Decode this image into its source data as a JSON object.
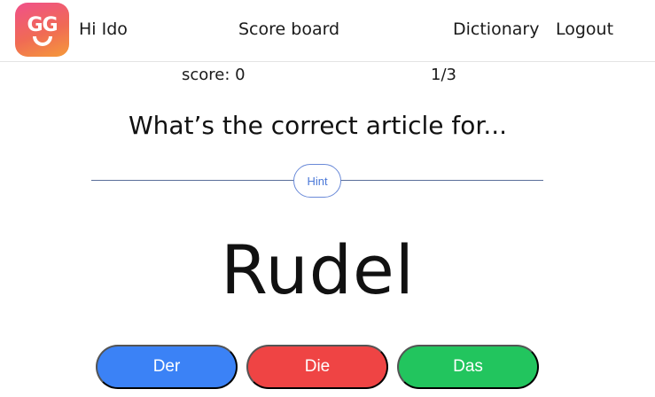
{
  "header": {
    "logo_text": "GG",
    "greeting": "Hi Ido",
    "nav": {
      "scoreboard": "Score board",
      "dictionary": "Dictionary",
      "logout": "Logout"
    }
  },
  "stats": {
    "score": "score: 0",
    "progress": "1/3"
  },
  "quiz": {
    "question": "What’s the correct article for...",
    "hint_label": "Hint",
    "word": "Rudel"
  },
  "answers": [
    {
      "label": "Der",
      "color": "#3b82f6"
    },
    {
      "label": "Die",
      "color": "#ef4444"
    },
    {
      "label": "Das",
      "color": "#22c55e"
    }
  ],
  "colors": {
    "logo_gradient_start": "#f0508a",
    "logo_gradient_end": "#f59a3a",
    "hint_accent": "#4a78d8"
  }
}
